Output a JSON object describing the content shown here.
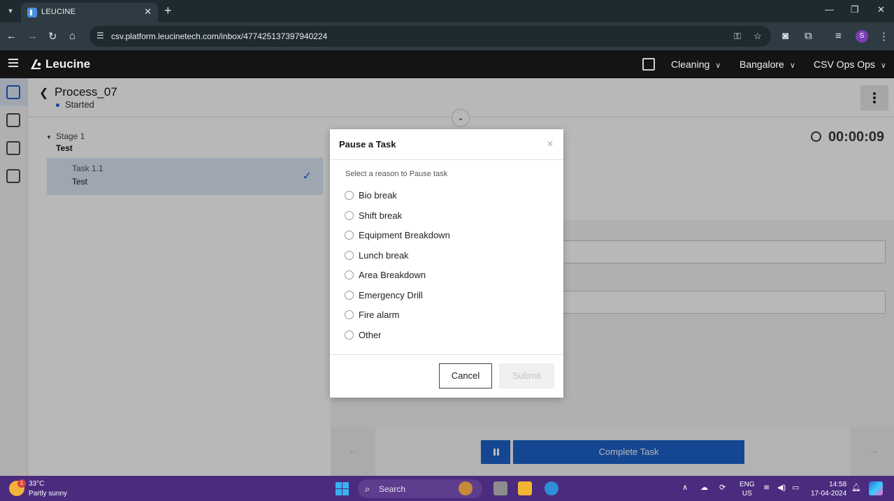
{
  "browser": {
    "tab_title": "LEUCINE",
    "url": "csv.platform.leucinetech.com/inbox/477425137397940224",
    "profile_initial": "S"
  },
  "app": {
    "brand": "Leucine",
    "facility_label": "Cleaning",
    "site_label": "Bangalore",
    "user_label": "CSV Ops Ops"
  },
  "process": {
    "title": "Process_07",
    "status": "Started"
  },
  "stages": [
    {
      "label": "Stage 1",
      "name": "Test",
      "tasks": [
        {
          "label": "Task 1.1",
          "name": "Test",
          "completed": true
        }
      ]
    }
  ],
  "task_panel": {
    "timer": "00:00:09",
    "complete_label": "Complete Task"
  },
  "modal": {
    "title": "Pause a Task",
    "prompt": "Select a reason to Pause task",
    "reasons": [
      "Bio break",
      "Shift break",
      "Equipment Breakdown",
      "Lunch break",
      "Area Breakdown",
      "Emergency Drill",
      "Fire alarm",
      "Other"
    ],
    "cancel_label": "Cancel",
    "submit_label": "Submit"
  },
  "taskbar": {
    "weather_temp": "33°C",
    "weather_desc": "Partly sunny",
    "weather_badge": "1",
    "search_label": "Search",
    "lang_line1": "ENG",
    "lang_line2": "US",
    "time": "14:58",
    "date": "17-04-2024"
  },
  "colors": {
    "accent": "#1d62c9",
    "header_bg": "#141414",
    "taskbar_bg": "#4a2b7e"
  }
}
